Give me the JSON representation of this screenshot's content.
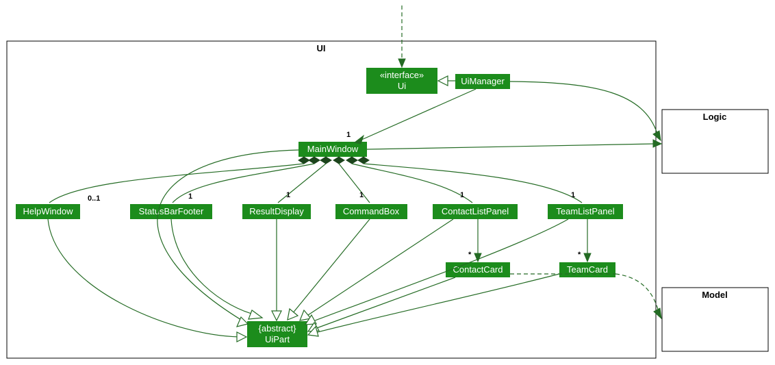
{
  "packages": {
    "ui": "UI",
    "logic": "Logic",
    "model": "Model"
  },
  "nodes": {
    "uiInterface": {
      "stereotype": "«interface»",
      "name": "Ui"
    },
    "uiManager": {
      "name": "UiManager"
    },
    "mainWindow": {
      "name": "MainWindow"
    },
    "helpWindow": {
      "name": "HelpWindow"
    },
    "statusBarFooter": {
      "name": "StatusBarFooter"
    },
    "resultDisplay": {
      "name": "ResultDisplay"
    },
    "commandBox": {
      "name": "CommandBox"
    },
    "contactListPanel": {
      "name": "ContactListPanel"
    },
    "teamListPanel": {
      "name": "TeamListPanel"
    },
    "contactCard": {
      "name": "ContactCard"
    },
    "teamCard": {
      "name": "TeamCard"
    },
    "uiPart": {
      "stereotype": "{abstract}",
      "name": "UiPart"
    }
  },
  "multiplicities": {
    "mainWindow": "1",
    "helpWindow": "0..1",
    "statusBarFooter": "1",
    "resultDisplay": "1",
    "commandBox": "1",
    "contactListPanel": "1",
    "teamListPanel": "1",
    "contactCard": "*",
    "teamCard": "*"
  },
  "chart_data": {
    "type": "diagram",
    "diagram_type": "UML class diagram",
    "packages": [
      "UI",
      "Logic",
      "Model"
    ],
    "classes": [
      {
        "name": "Ui",
        "stereotype": "interface",
        "package": "UI"
      },
      {
        "name": "UiManager",
        "package": "UI"
      },
      {
        "name": "MainWindow",
        "package": "UI"
      },
      {
        "name": "HelpWindow",
        "package": "UI"
      },
      {
        "name": "StatusBarFooter",
        "package": "UI"
      },
      {
        "name": "ResultDisplay",
        "package": "UI"
      },
      {
        "name": "CommandBox",
        "package": "UI"
      },
      {
        "name": "ContactListPanel",
        "package": "UI"
      },
      {
        "name": "TeamListPanel",
        "package": "UI"
      },
      {
        "name": "ContactCard",
        "package": "UI"
      },
      {
        "name": "TeamCard",
        "package": "UI"
      },
      {
        "name": "UiPart",
        "stereotype": "abstract",
        "package": "UI"
      }
    ],
    "relationships": [
      {
        "from": "(external)",
        "to": "Ui",
        "type": "dependency"
      },
      {
        "from": "UiManager",
        "to": "Ui",
        "type": "realization"
      },
      {
        "from": "UiManager",
        "to": "MainWindow",
        "type": "association",
        "multiplicity": "1"
      },
      {
        "from": "UiManager",
        "to": "Logic",
        "type": "association"
      },
      {
        "from": "MainWindow",
        "to": "Logic",
        "type": "association"
      },
      {
        "from": "MainWindow",
        "to": "HelpWindow",
        "type": "composition",
        "multiplicity": "0..1"
      },
      {
        "from": "MainWindow",
        "to": "StatusBarFooter",
        "type": "composition",
        "multiplicity": "1"
      },
      {
        "from": "MainWindow",
        "to": "ResultDisplay",
        "type": "composition",
        "multiplicity": "1"
      },
      {
        "from": "MainWindow",
        "to": "CommandBox",
        "type": "composition",
        "multiplicity": "1"
      },
      {
        "from": "MainWindow",
        "to": "ContactListPanel",
        "type": "composition",
        "multiplicity": "1"
      },
      {
        "from": "MainWindow",
        "to": "TeamListPanel",
        "type": "composition",
        "multiplicity": "1"
      },
      {
        "from": "ContactListPanel",
        "to": "ContactCard",
        "type": "association",
        "multiplicity": "*"
      },
      {
        "from": "TeamListPanel",
        "to": "TeamCard",
        "type": "association",
        "multiplicity": "*"
      },
      {
        "from": "MainWindow",
        "to": "UiPart",
        "type": "generalization"
      },
      {
        "from": "HelpWindow",
        "to": "UiPart",
        "type": "generalization"
      },
      {
        "from": "StatusBarFooter",
        "to": "UiPart",
        "type": "generalization"
      },
      {
        "from": "ResultDisplay",
        "to": "UiPart",
        "type": "generalization"
      },
      {
        "from": "CommandBox",
        "to": "UiPart",
        "type": "generalization"
      },
      {
        "from": "ContactListPanel",
        "to": "UiPart",
        "type": "generalization"
      },
      {
        "from": "TeamListPanel",
        "to": "UiPart",
        "type": "generalization"
      },
      {
        "from": "ContactCard",
        "to": "UiPart",
        "type": "generalization"
      },
      {
        "from": "TeamCard",
        "to": "UiPart",
        "type": "generalization"
      },
      {
        "from": "TeamCard",
        "to": "Model",
        "type": "dependency"
      },
      {
        "from": "ContactCard",
        "to": "Model",
        "type": "dependency"
      }
    ]
  }
}
